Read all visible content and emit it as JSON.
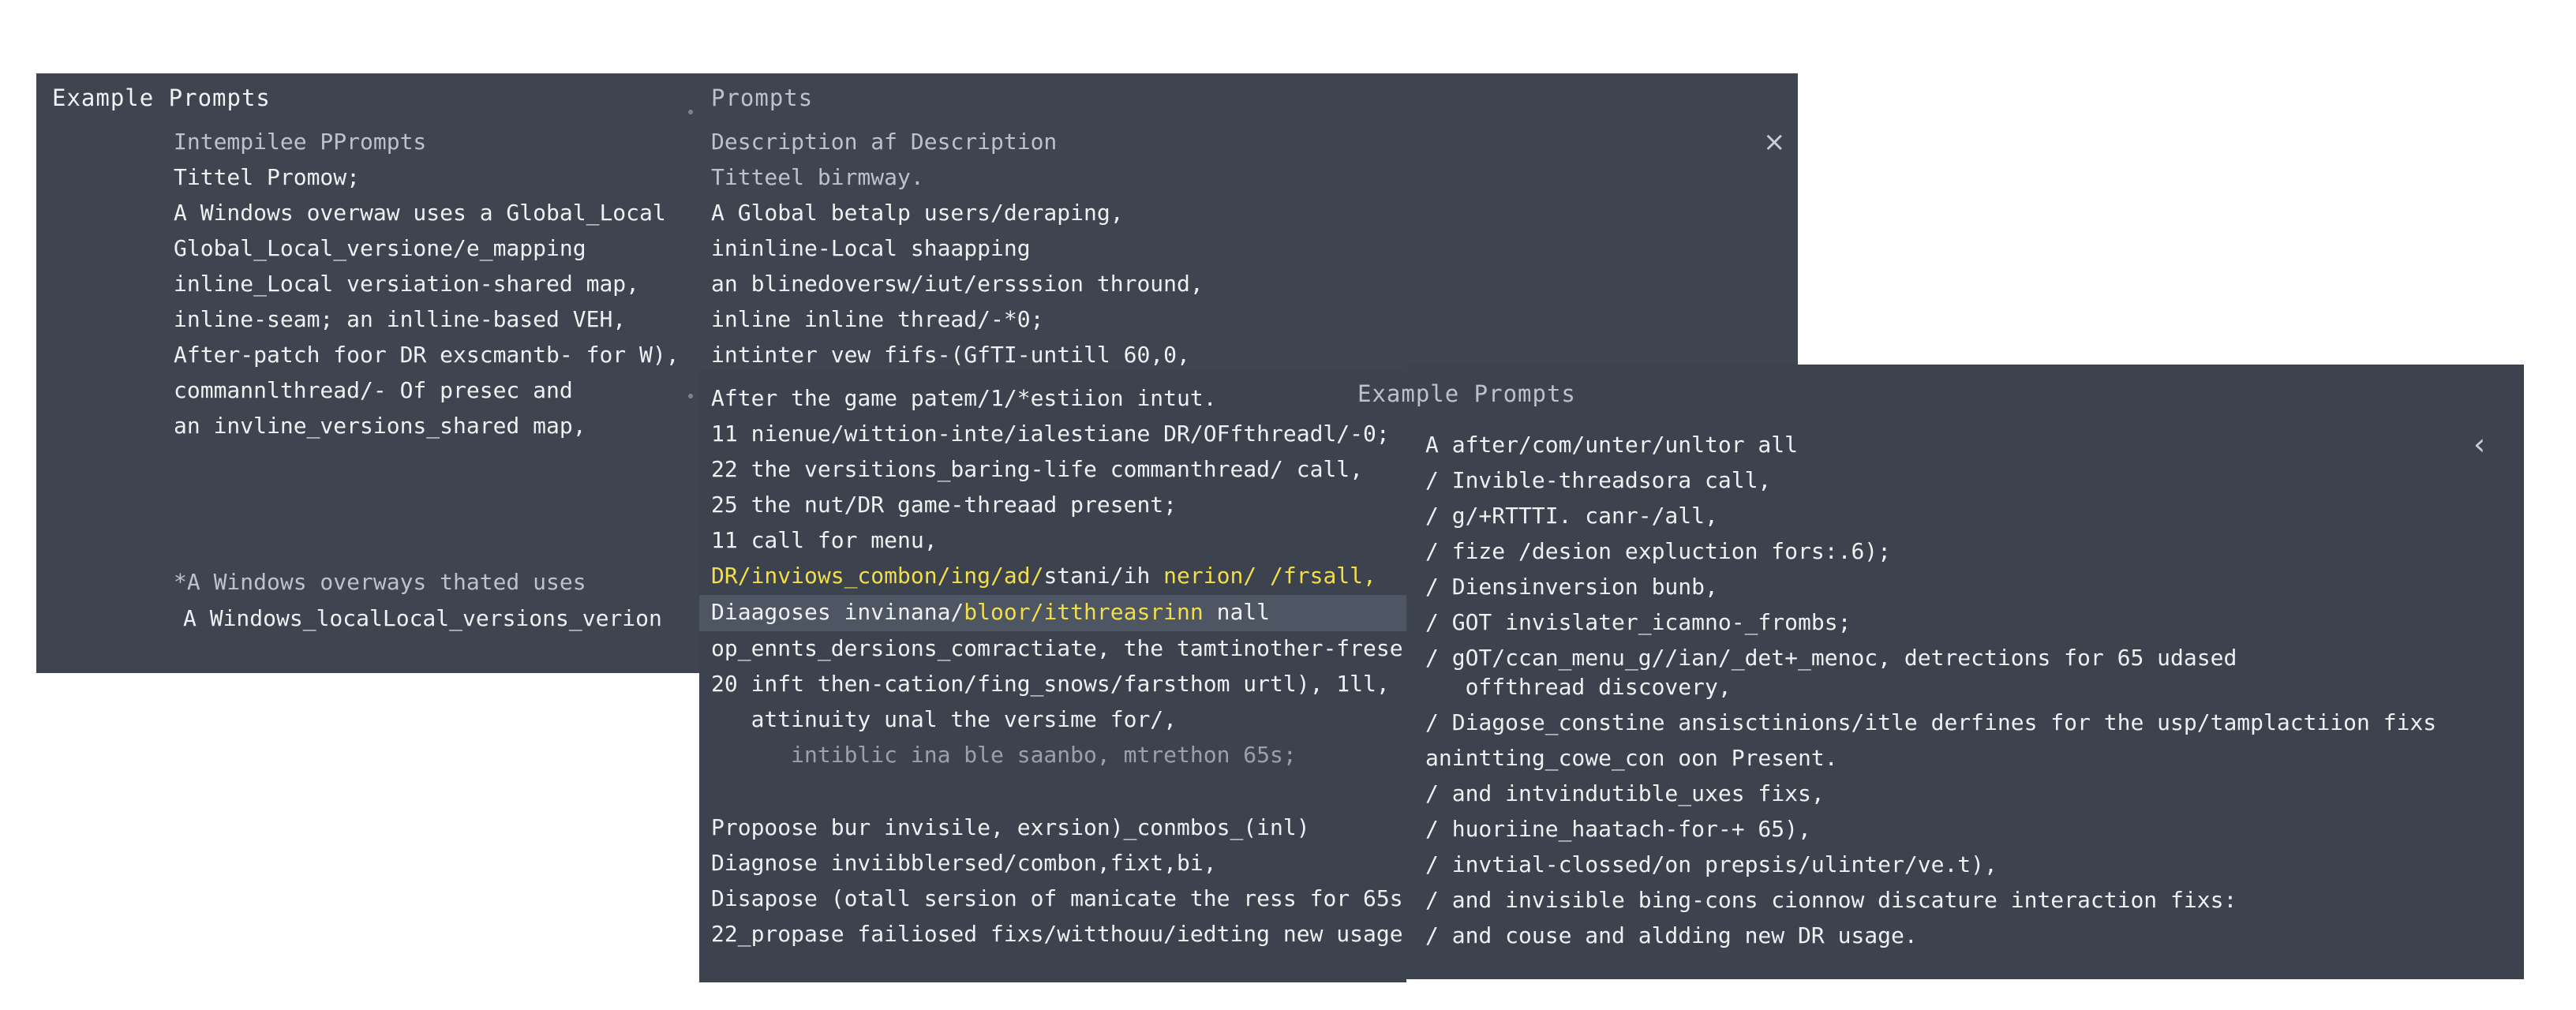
{
  "panel_a": {
    "title_left": "Example Prompts",
    "title_right": "Prompts",
    "left_lines": [
      "Intempilee PPrompts",
      "Tittel Promow;",
      "A Windows overwaw uses a Global_Local",
      "Global_Local_versione/e_mapping",
      "inline_Local versiation-shared map,",
      "inline-seam;  an  inlline-based VEH,",
      "After-patch foor DR exscmantb- for W),",
      "commannlthread/- Of presec and",
      "an invline_versions_shared map,"
    ],
    "left_footer": [
      "*A Windows overways thated uses",
      "A Windows_localLocal_versions_verion"
    ],
    "right_lines": [
      "Description af Description",
      "Titteel birmway.",
      "A Global betalp users/deraping,",
      "ininline-Local shaapping",
      "an blinedoversw/iut/ersssion thround,",
      "inline inline thread/-*0;",
      "intinter vew fifs-(GfTI-untill 60,0,"
    ],
    "close_glyph": "×"
  },
  "panel_b": {
    "lines_top": [
      "After the game patem/1/*estiion intut.",
      "11 nienue/wittion-inte/ialestiane DR/OFfthreadl/-0;",
      "22 the versitions_baring-life commanthread/ call,",
      "25 the nut/DR game-threaad present;",
      "11 call for menu,"
    ],
    "highlight_line": {
      "part1": "DR/inviows_combon/ing/ad/",
      "part2": "stani/ih",
      "part3": " nerion/ /frsall,"
    },
    "selected_line": {
      "part1": "Diaagoses invinana/",
      "part2": "bloor/itthreasrinn",
      "part3": " nall"
    },
    "lines_mid": [
      "op_ennts_dersions_comractiate, the tamtinother-fresed",
      "20 inft then-cation/fing_snows/farsthom urtl), 1ll,",
      "   attinuity unal the versime for/,"
    ],
    "faint_line": "      intiblic ina ble saanbo, mtrethon 65s;",
    "lines_bottom": [
      "Propoose bur invisile, exrsion)_conmbos_(inl)",
      "Diagnose inviibblersed/combon,fixt,bi,",
      "Disapose (otall sersion of manicate the ress for 65s",
      "22_propase failiosed fixs/witthouu/iedting new usage"
    ]
  },
  "panel_c": {
    "title": "Example Prompts",
    "collapse_glyph": "‹",
    "lines": [
      "A after/com/unter/unltor all",
      "/ Invible-threadsora call,",
      "/ g/+RTTTI. canr-/all,",
      "/ fize /desion expluction fors:.6);",
      "/ Diensinversion bunb,",
      "/ GOT invislater_icamno-_frombs;",
      "/ gOT/ccan_menu_g//ian/_det+_menoc, detrections for 65 udased",
      "   offthread discovery,",
      "/ Diagose_constine ansisctinions/itle derfines for the usp/tamplactiion fixs",
      "anintting_cowe_con oon Present.",
      "/ and intvindutible_uxes fixs,",
      "/ huoriine_haatach-for-+ 65),",
      "/ invtial-clossed/on prepsis/ulinter/ve.t),",
      "/ and invisible bing-cons cionnow discature interaction fixs:",
      "/ and couse and aldding new DR usage."
    ]
  },
  "colors": {
    "panel_bg": "#3e4450",
    "highlight_text": "#f2dd4a",
    "selected_row_bg": "#4f5663"
  }
}
